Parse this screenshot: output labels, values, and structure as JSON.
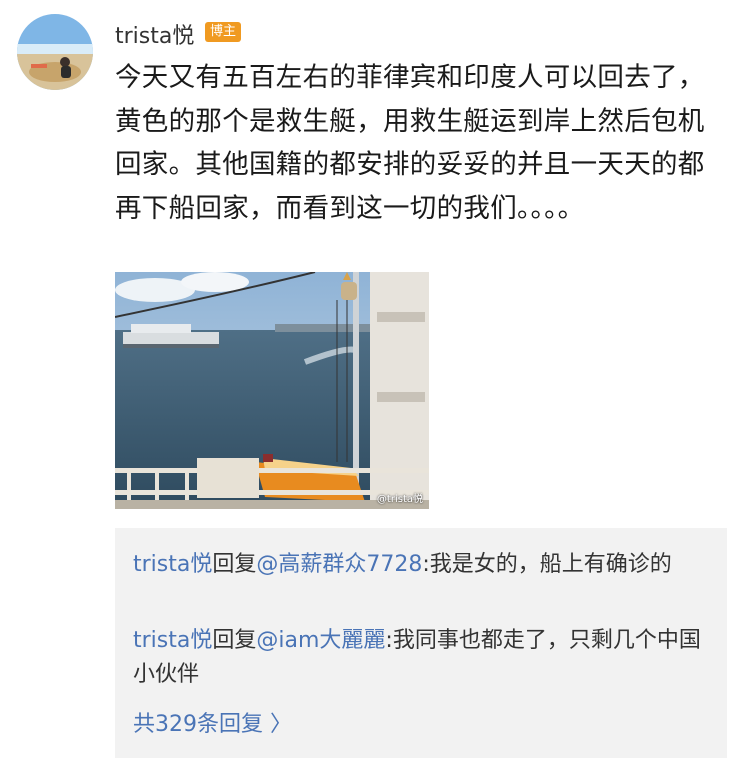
{
  "post": {
    "username": "trista悦",
    "badge": "博主",
    "text": "今天又有五百左右的菲律宾和印度人可以回去了，黄色的那个是救生艇，用救生艇运到岸上然后包机回家。其他国籍的都安排的妥妥的并且一天天的都再下船回家，而看到这一切的我们。。。。",
    "photo_watermark": "@trista悦",
    "icons": {
      "avatar": "profile-photo",
      "photo": "ship-deck-photo"
    }
  },
  "replies": [
    {
      "author": "trista悦",
      "verb": "回复",
      "mention": "@高薪群众7728",
      "text": ":我是女的，船上有确诊的"
    },
    {
      "author": "trista悦",
      "verb": "回复",
      "mention": "@iam大麗麗",
      "text": ":我同事也都走了，只剩几个中国小伙伴"
    }
  ],
  "more_replies": "共329条回复 〉",
  "colors": {
    "link": "#4a74b6",
    "badge": "#f09a21",
    "reply_bg": "#f2f2f2"
  }
}
